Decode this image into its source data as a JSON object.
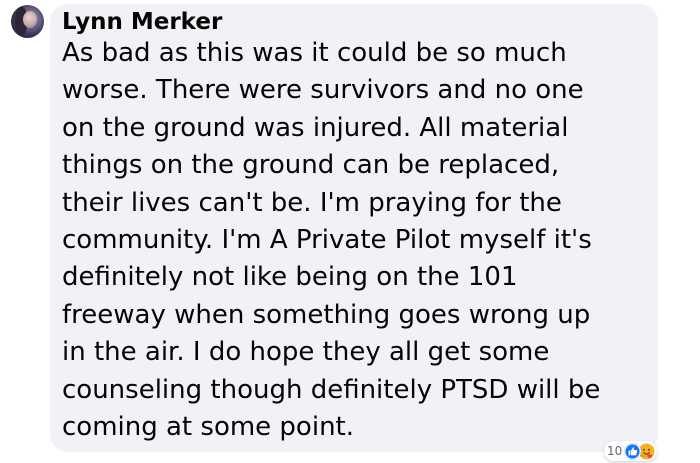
{
  "comment": {
    "author": "Lynn Merker",
    "text": "As bad as this was it could be so much\nworse. There were survivors and no one\non the ground was injured. All material\nthings on the ground can be replaced,\ntheir lives can't be. I'm praying for the\ncommunity. I'm A Private Pilot myself it's\ndefinitely not like being on the 101\nfreeway when something goes wrong up\nin the air. I do hope they all get some\ncounseling though definitely PTSD will be\ncoming at some point.",
    "reactions": {
      "count": "10",
      "icons": [
        "like-icon",
        "care-icon"
      ]
    }
  },
  "colors": {
    "bubble_background": "#f0f2f5",
    "text": "#050505",
    "like_blue": "#1877f2",
    "care_yellow": "#f7b125",
    "muted_text": "#65676b"
  }
}
